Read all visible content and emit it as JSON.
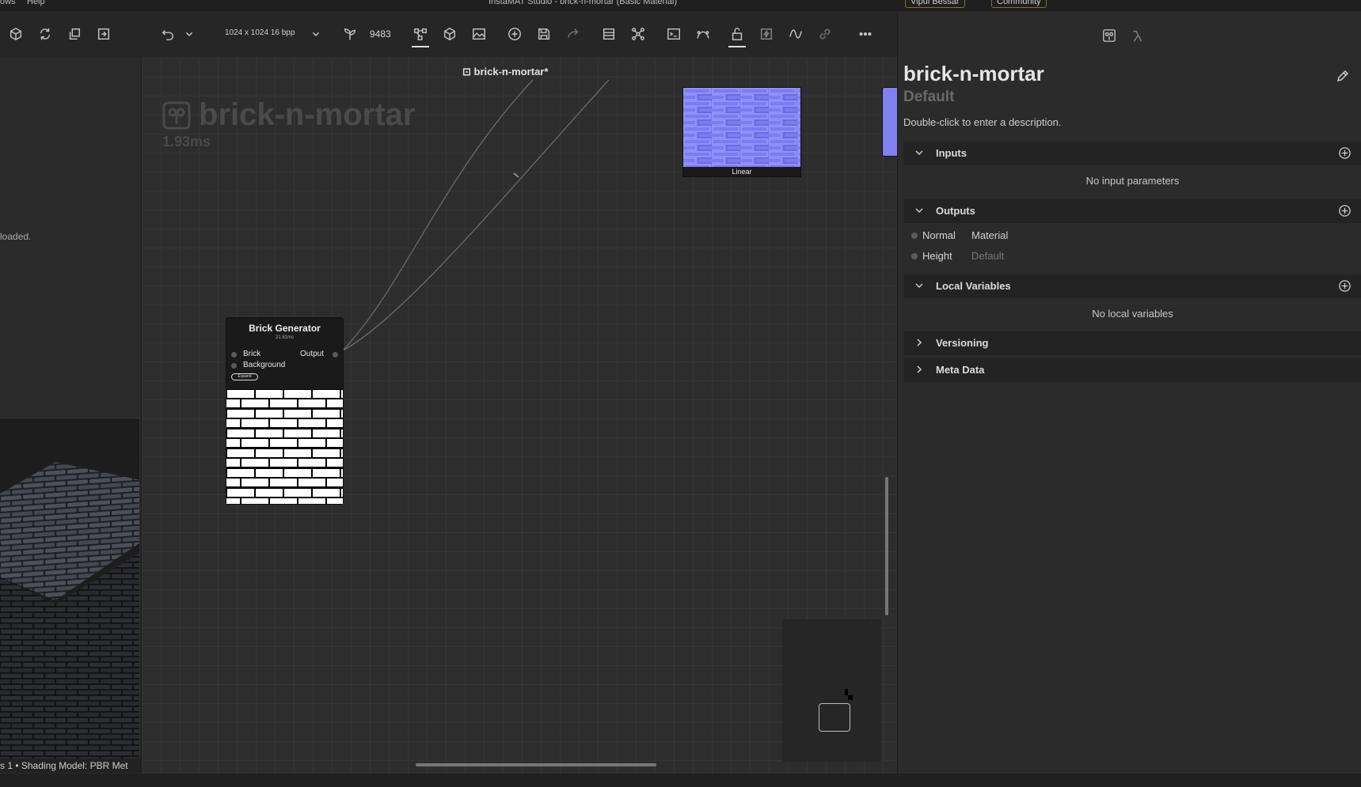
{
  "window": {
    "title": "InstaMAT Studio - brick-n-mortar (Basic Material)",
    "menu_items": [
      "ows",
      "Help"
    ],
    "user_label": "Vipul Bessar",
    "community_label": "Community"
  },
  "toolbar": {
    "resolution": "1024 x 1024 16 bpp",
    "seed": "9483"
  },
  "left_panel": {
    "status_text": "loaded.",
    "viewport_info": "s 1 • Shading Model: PBR Met"
  },
  "graph": {
    "tab_title": "brick-n-mortar*",
    "watermark_title": "brick-n-mortar",
    "eval_time": "1.93ms",
    "brick_node": {
      "title": "Brick Generator",
      "time": "21.81ms",
      "input_brick": "Brick",
      "input_background": "Background",
      "output": "Output",
      "expand_label": "Expand"
    },
    "normal_node": {
      "label": "Linear"
    }
  },
  "right_panel": {
    "name": "brick-n-mortar",
    "variant": "Default",
    "description": "Double-click to enter a description.",
    "sections": {
      "inputs": {
        "title": "Inputs",
        "empty": "No input parameters"
      },
      "outputs": {
        "title": "Outputs",
        "items": [
          {
            "name": "Normal",
            "type": "Material"
          },
          {
            "name": "Height",
            "type": "Default"
          }
        ]
      },
      "local_variables": {
        "title": "Local Variables",
        "empty": "No local variables"
      },
      "versioning": {
        "title": "Versioning"
      },
      "meta_data": {
        "title": "Meta Data"
      }
    }
  },
  "colors": {
    "normal_map": "#8080f0",
    "accent_pill": "#8a6a2a"
  }
}
